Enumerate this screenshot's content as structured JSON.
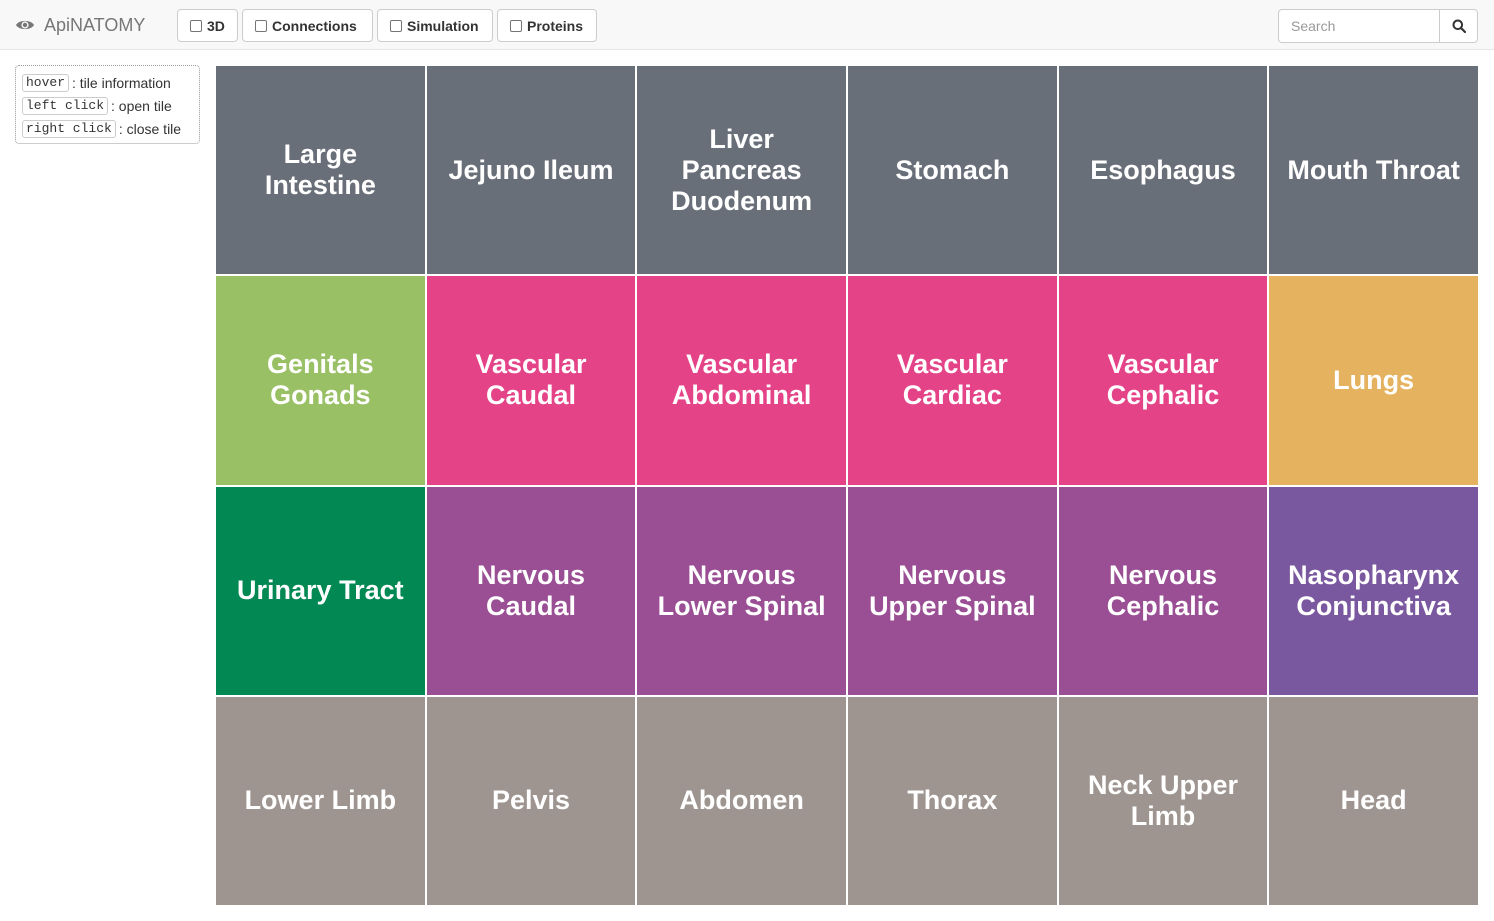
{
  "app": {
    "brand": "ApiNATOMY",
    "toggles": [
      "3D",
      "Connections",
      "Simulation",
      "Proteins"
    ],
    "search_placeholder": "Search"
  },
  "legend": [
    {
      "key": "hover",
      "desc": ": tile information"
    },
    {
      "key": "left click",
      "desc": ": open tile"
    },
    {
      "key": "right click",
      "desc": ": close tile"
    }
  ],
  "colors": {
    "gray_dark": "#686f78",
    "green_light": "#99c064",
    "pink": "#e44388",
    "orange": "#e5b25f",
    "green_dark": "#028852",
    "purple": "#9a4f95",
    "violet": "#7a589f",
    "gray_light": "#9e9590"
  },
  "tiles": [
    {
      "label": "Large Intestine",
      "color": "#686f78"
    },
    {
      "label": "Jejuno Ileum",
      "color": "#686f78"
    },
    {
      "label": "Liver Pancreas Duodenum",
      "color": "#686f78"
    },
    {
      "label": "Stomach",
      "color": "#686f78"
    },
    {
      "label": "Esophagus",
      "color": "#686f78"
    },
    {
      "label": "Mouth Throat",
      "color": "#686f78"
    },
    {
      "label": "Genitals Gonads",
      "color": "#99c064"
    },
    {
      "label": "Vascular Caudal",
      "color": "#e44388"
    },
    {
      "label": "Vascular Abdominal",
      "color": "#e44388"
    },
    {
      "label": "Vascular Cardiac",
      "color": "#e44388"
    },
    {
      "label": "Vascular Cephalic",
      "color": "#e44388"
    },
    {
      "label": "Lungs",
      "color": "#e5b25f"
    },
    {
      "label": "Urinary Tract",
      "color": "#028852"
    },
    {
      "label": "Nervous Caudal",
      "color": "#9a4f95"
    },
    {
      "label": "Nervous Lower Spinal",
      "color": "#9a4f95"
    },
    {
      "label": "Nervous Upper Spinal",
      "color": "#9a4f95"
    },
    {
      "label": "Nervous Cephalic",
      "color": "#9a4f95"
    },
    {
      "label": "Nasopharynx Conjunctiva",
      "color": "#7a589f"
    },
    {
      "label": "Lower Limb",
      "color": "#9e9590"
    },
    {
      "label": "Pelvis",
      "color": "#9e9590"
    },
    {
      "label": "Abdomen",
      "color": "#9e9590"
    },
    {
      "label": "Thorax",
      "color": "#9e9590"
    },
    {
      "label": "Neck Upper Limb",
      "color": "#9e9590"
    },
    {
      "label": "Head",
      "color": "#9e9590"
    }
  ]
}
